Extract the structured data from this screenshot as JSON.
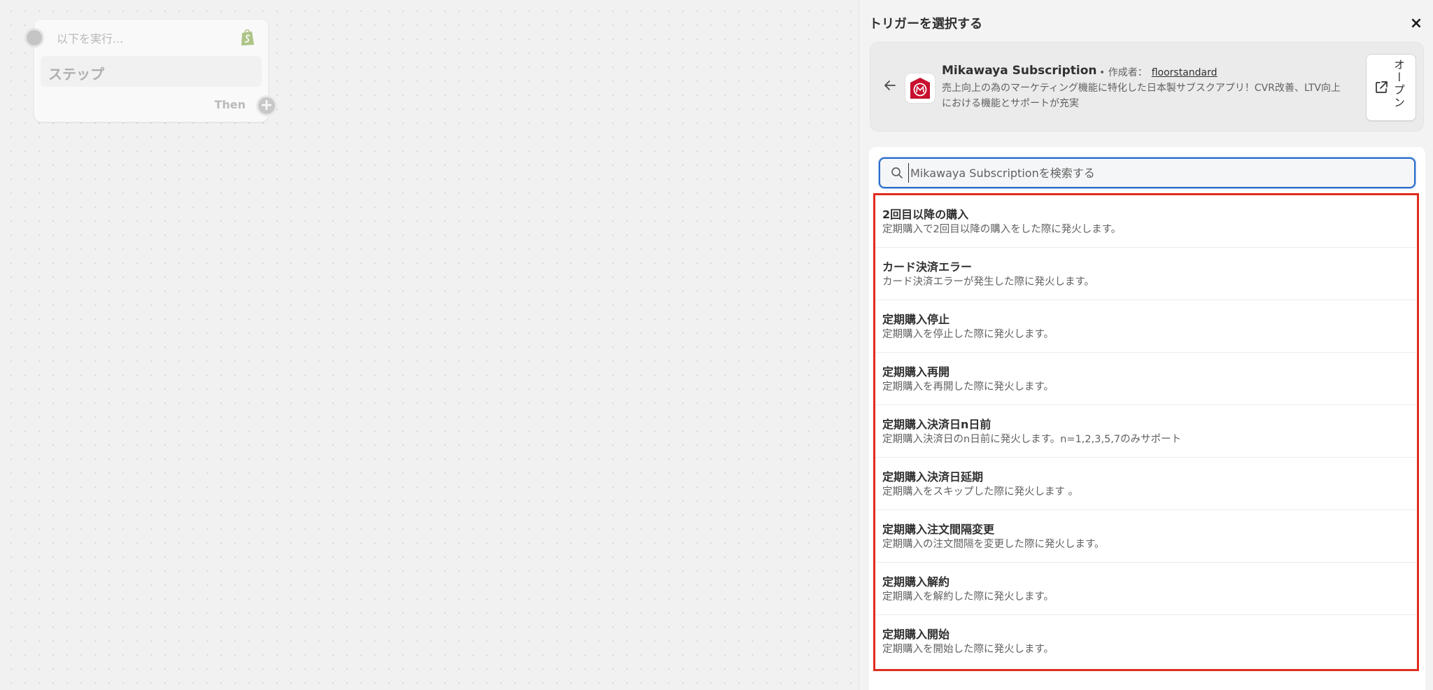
{
  "canvas": {
    "step": {
      "run_label": "以下を実行...",
      "title": "ステップ",
      "then_label": "Then",
      "plus_symbol": "+"
    }
  },
  "panel": {
    "title": "トリガーを選択する",
    "close_symbol": "×",
    "app": {
      "name": "Mikawaya Subscription",
      "meta_prefix": "• 作成者：",
      "author": "floorstandard",
      "description": "売上向上の為のマーケティング機能に特化した日本製サブスクアプリ！CVR改善、LTV向上における機能とサポートが充実",
      "open_label": "オープン",
      "logo_color": "#c8102e"
    },
    "search": {
      "placeholder": "Mikawaya Subscriptionを検索する",
      "value": ""
    },
    "triggers": [
      {
        "name": "2回目以降の購入",
        "desc": "定期購入で2回目以降の購入をした際に発火します。"
      },
      {
        "name": "カード決済エラー",
        "desc": "カード決済エラーが発生した際に発火します。"
      },
      {
        "name": "定期購入停止",
        "desc": "定期購入を停止した際に発火します。"
      },
      {
        "name": "定期購入再開",
        "desc": "定期購入を再開した際に発火します。"
      },
      {
        "name": "定期購入決済日n日前",
        "desc": "定期購入決済日のn日前に発火します。n=1,2,3,5,7のみサポート"
      },
      {
        "name": "定期購入決済日延期",
        "desc": "定期購入をスキップした際に発火します 。"
      },
      {
        "name": "定期購入注文間隔変更",
        "desc": "定期購入の注文間隔を変更した際に発火します。"
      },
      {
        "name": "定期購入解約",
        "desc": "定期購入を解約した際に発火します。"
      },
      {
        "name": "定期購入開始",
        "desc": "定期購入を開始した際に発火します。"
      }
    ],
    "highlight_color": "#e02c1e"
  }
}
